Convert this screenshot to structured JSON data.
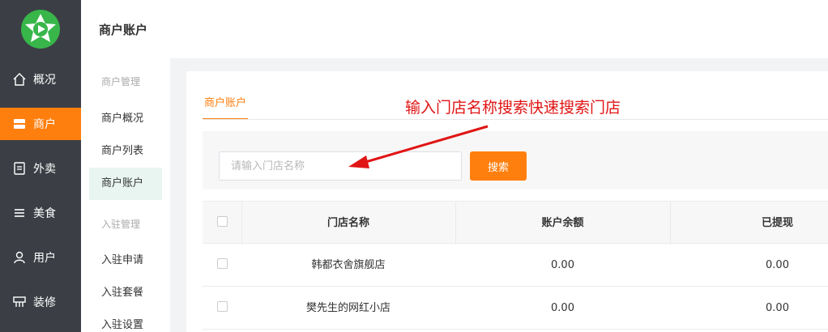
{
  "nav": {
    "items": [
      {
        "label": "概况",
        "icon": "home-icon"
      },
      {
        "label": "商户",
        "icon": "store-icon"
      },
      {
        "label": "外卖",
        "icon": "document-icon"
      },
      {
        "label": "美食",
        "icon": "menu-icon"
      },
      {
        "label": "用户",
        "icon": "user-icon"
      },
      {
        "label": "装修",
        "icon": "decorate-icon"
      }
    ],
    "active_index": 1,
    "accent_color": "#ff7f0e"
  },
  "header": {
    "title": "商户账户"
  },
  "subnav": {
    "group1": "商户管理",
    "group1_items": [
      "商户概况",
      "商户列表",
      "商户账户"
    ],
    "group2": "入驻管理",
    "group2_items": [
      "入驻申请",
      "入驻套餐",
      "入驻设置"
    ],
    "active_item": "商户账户"
  },
  "main": {
    "tab_label": "商户账户",
    "annotation": "输入门店名称搜索快速搜索门店",
    "search": {
      "placeholder": "请输入门店名称",
      "value": "",
      "button_label": "搜索"
    },
    "table": {
      "columns": [
        "门店名称",
        "账户余额",
        "已提现"
      ],
      "rows": [
        [
          "韩都衣舍旗舰店",
          "0.00",
          "0.00"
        ],
        [
          "樊先生的网红小店",
          "0.00",
          "0.00"
        ]
      ]
    }
  }
}
